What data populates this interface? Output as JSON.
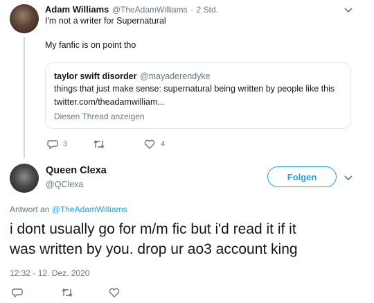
{
  "colors": {
    "accent": "#1da1f2",
    "muted": "#657786",
    "text": "#14171a",
    "border": "#e1e8ed"
  },
  "first_tweet": {
    "name": "Adam Williams",
    "handle": "@TheAdamWilliams",
    "separator": "·",
    "time": "2 Std.",
    "line1": "I'm not a writer for Supernatural",
    "line2": "My fanfic is on point tho",
    "quoted": {
      "name": "taylor swift disorder",
      "handle": "@mayaderendyke",
      "text": "things that just make sense: supernatural being written by people like this",
      "link": "twitter.com/theadamwilliam...",
      "show_thread": "Diesen Thread anzeigen"
    },
    "actions": {
      "reply_count": "3",
      "retweet_count": "",
      "like_count": "4"
    }
  },
  "main_tweet": {
    "name": "Queen Clexa",
    "handle": "@QClexa",
    "follow_label": "Folgen",
    "reply_prefix": "Antwort an ",
    "reply_to": "@TheAdamWilliams",
    "line1": "i dont usually go for m/m fic but i'd read it if it",
    "line2": "was written by you. drop ur ao3 account king",
    "timestamp": "12:32 - 12. Dez. 2020"
  },
  "icons": [
    "reply-icon",
    "retweet-icon",
    "like-icon",
    "chevron-down-icon"
  ]
}
